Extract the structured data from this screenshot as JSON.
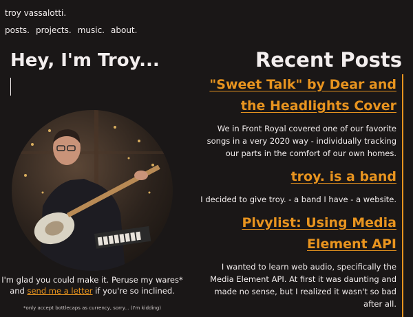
{
  "site": {
    "title": "troy vassalotti."
  },
  "nav": {
    "items": [
      "posts.",
      "projects.",
      "music.",
      "about."
    ]
  },
  "hero": {
    "title": "Hey, I'm Troy...",
    "welcome_prefix": "I'm glad you could make it. Peruse my wares* and ",
    "welcome_link": "send me a letter",
    "welcome_suffix": " if you're so inclined.",
    "fineprint": "*only accept bottlecaps as currency, sorry... (I'm kidding)"
  },
  "recent": {
    "title": "Recent Posts",
    "posts": [
      {
        "title": "\"Sweet Talk\" by Dear and the Headlights Cover",
        "excerpt": "We in Front Royal covered one of our favorite songs in a very 2020 way - individually tracking our parts in the comfort of our own homes."
      },
      {
        "title": "troy. is a band",
        "excerpt": "I decided to give troy. - a band I have - a website."
      },
      {
        "title": "Plvylist: Using Media Element API",
        "excerpt": "I wanted to learn web audio, specifically the Media Element API. At first it was daunting and made no sense, but I realized it wasn't so bad after all."
      }
    ]
  },
  "colors": {
    "background": "#1a1717",
    "text": "#f3eeee",
    "accent": "#e8941f"
  }
}
